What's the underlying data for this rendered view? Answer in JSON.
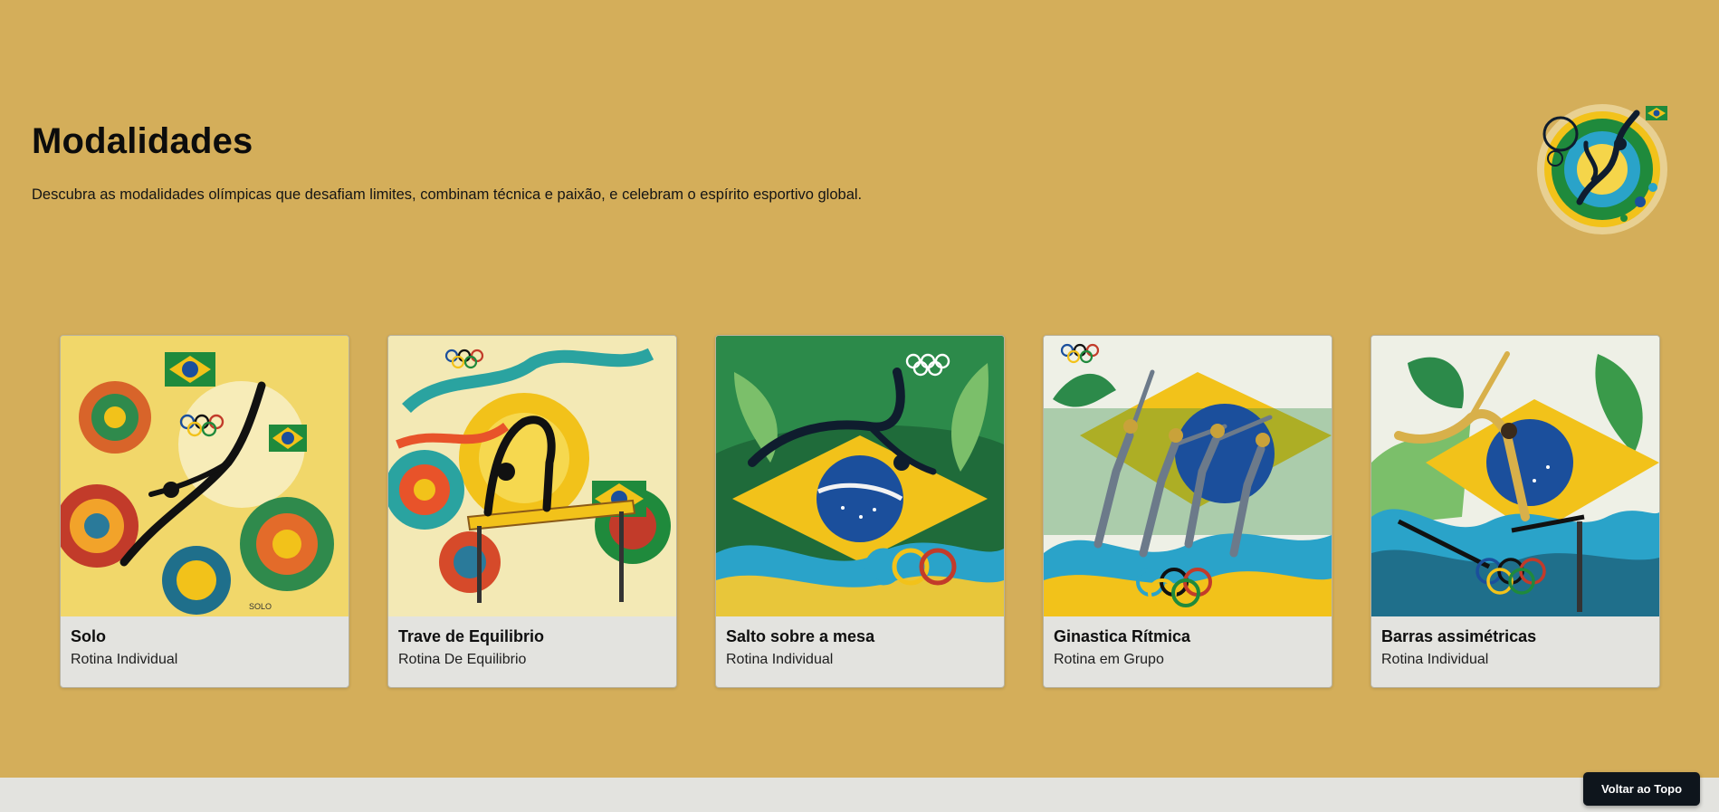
{
  "hero": {
    "title": "Modalidades",
    "description": "Descubra as modalidades olímpicas que desafiam limites, combinam técnica e paixão, e celebram o espírito esportivo global."
  },
  "cards": [
    {
      "title": "Solo",
      "subtitle": "Rotina Individual",
      "image_label": "SOLO"
    },
    {
      "title": "Trave de Equilibrio",
      "subtitle": "Rotina De Equilibrio"
    },
    {
      "title": "Salto sobre a mesa",
      "subtitle": "Rotina Individual"
    },
    {
      "title": "Ginastica Rítmica",
      "subtitle": "Rotina em Grupo"
    },
    {
      "title": "Barras assimétricas",
      "subtitle": "Rotina Individual"
    }
  ],
  "back_to_top": {
    "label": "Voltar ao Topo"
  },
  "colors": {
    "background": "#d4ae5a",
    "card": "#e3e3df",
    "button": "#0e151c",
    "brazil_green": "#1f8a3c",
    "brazil_yellow": "#f2c21a",
    "brazil_blue": "#1b4f9c"
  }
}
